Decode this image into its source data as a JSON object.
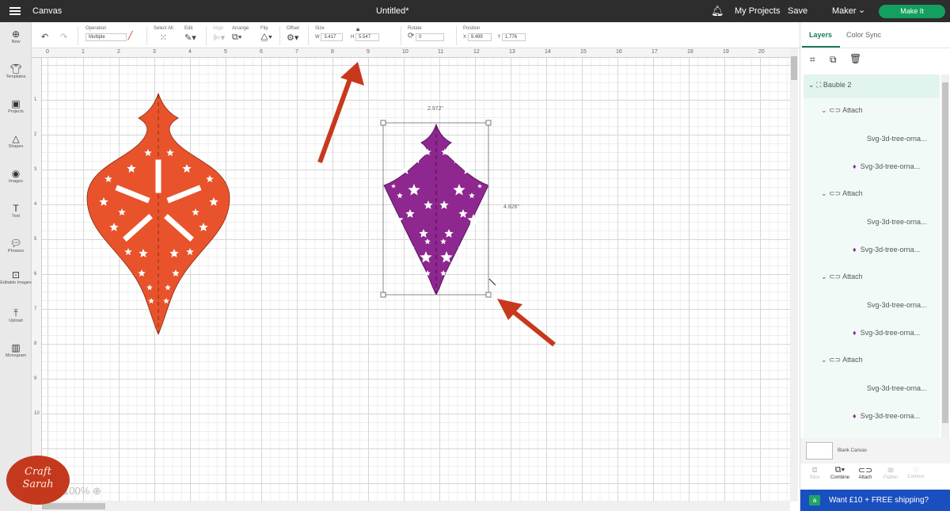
{
  "topbar": {
    "app_title": "Canvas",
    "doc_title": "Untitled*",
    "my_projects": "My Projects",
    "save": "Save",
    "machine": "Maker",
    "make_it": "Make It"
  },
  "toolbar": {
    "operation_label": "Operation",
    "operation_value": "Multiple",
    "select_all": "Select All",
    "edit": "Edit",
    "align": "Align",
    "arrange": "Arrange",
    "flip": "Flip",
    "offset": "Offset",
    "size_label": "Size",
    "w_label": "W",
    "w_value": "3.417",
    "h_label": "H",
    "h_value": "5.547",
    "rotate_label": "Rotate",
    "rotate_value": "0",
    "position_label": "Position",
    "x_label": "X",
    "x_value": "9.499",
    "y_label": "Y",
    "y_value": "1.776"
  },
  "sidebar": {
    "items": [
      {
        "label": "New"
      },
      {
        "label": "Templates"
      },
      {
        "label": "Projects"
      },
      {
        "label": "Shapes"
      },
      {
        "label": "Images"
      },
      {
        "label": "Text"
      },
      {
        "label": "Phrases"
      },
      {
        "label": "Editable Images"
      },
      {
        "label": "Upload"
      },
      {
        "label": "Monogram"
      }
    ]
  },
  "ruler": {
    "top": [
      "0",
      "1",
      "2",
      "3",
      "4",
      "5",
      "6",
      "7",
      "8",
      "9",
      "10",
      "11",
      "12",
      "13",
      "14",
      "15",
      "16",
      "17",
      "18",
      "19",
      "20"
    ],
    "left": [
      "1",
      "2",
      "3",
      "4",
      "5",
      "6",
      "7",
      "8",
      "9",
      "10"
    ]
  },
  "canvas": {
    "selection_width": "2.972\"",
    "selection_height": "4.826\"",
    "zoom": "100%",
    "orange_color": "#e8532b",
    "purple_color": "#8e2790"
  },
  "watermark": {
    "text": "Craft with Sarah"
  },
  "panel": {
    "tabs": [
      "Layers",
      "Color Sync"
    ],
    "group": "Bauble 2",
    "layers": [
      {
        "attach": "Attach",
        "items": [
          "Svg-3d-tree-orna...",
          "Svg-3d-tree-orna..."
        ]
      },
      {
        "attach": "Attach",
        "items": [
          "Svg-3d-tree-orna...",
          "Svg-3d-tree-orna..."
        ]
      },
      {
        "attach": "Attach",
        "items": [
          "Svg-3d-tree-orna...",
          "Svg-3d-tree-orna..."
        ]
      },
      {
        "attach": "Attach",
        "items": [
          "Svg-3d-tree-orna...",
          "Svg-3d-tree-orna..."
        ]
      }
    ],
    "blank_canvas": "Blank Canvas",
    "tools": [
      "Slice",
      "Combine",
      "Attach",
      "Flatten",
      "Contour"
    ],
    "promo": "Want £10 + FREE shipping?"
  }
}
